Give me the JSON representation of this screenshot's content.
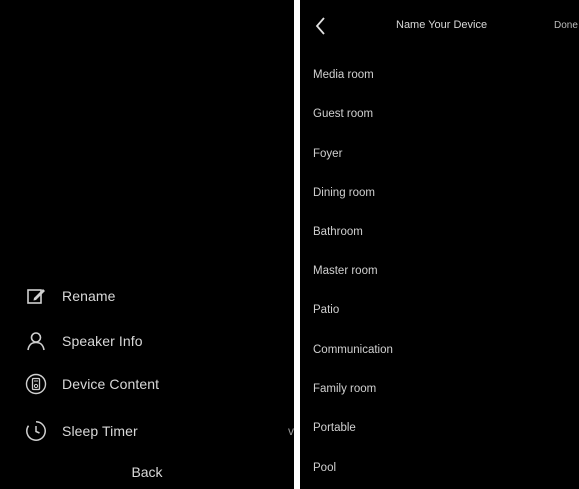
{
  "left_menu": {
    "items": [
      {
        "label": "Rename",
        "icon": "edit-icon",
        "edge": ""
      },
      {
        "label": "Speaker Info",
        "icon": "person-icon",
        "edge": ""
      },
      {
        "label": "Device Content",
        "icon": "device-content-icon",
        "edge": ""
      },
      {
        "label": "Sleep Timer",
        "icon": "timer-icon",
        "edge": "v"
      }
    ],
    "back_label": "Back"
  },
  "name_device": {
    "title": "Name Your Device",
    "right_action": "Done",
    "rooms": [
      "Media room",
      "Guest room",
      "Foyer",
      "Dining room",
      "Bathroom",
      "Master room",
      "Patio",
      "Communication",
      "Family room",
      "Portable",
      "Pool"
    ]
  }
}
